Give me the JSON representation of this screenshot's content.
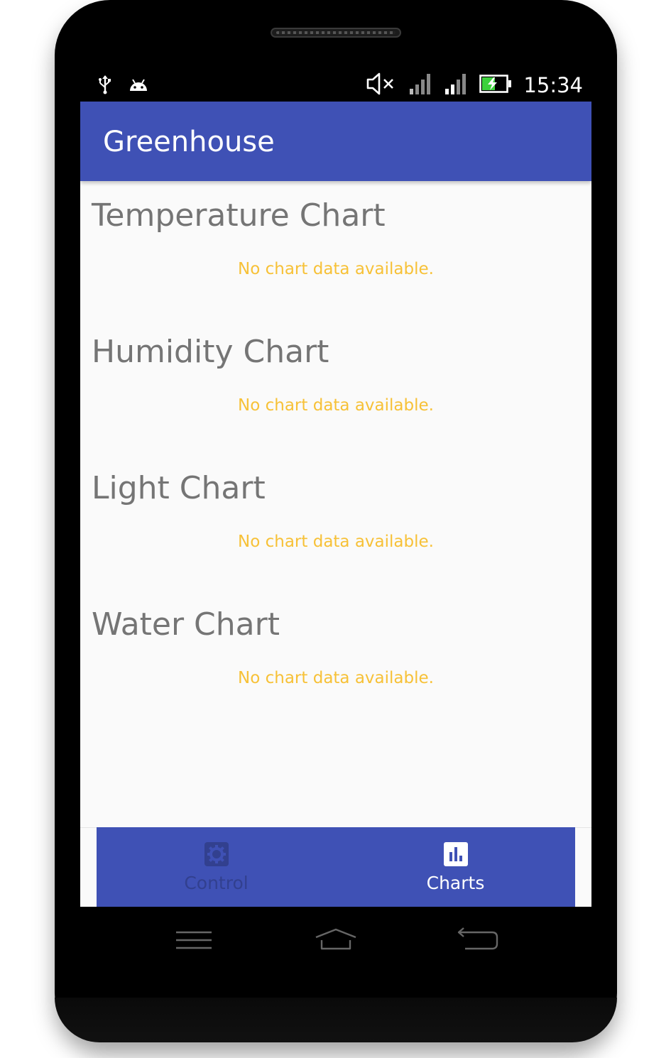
{
  "status_bar": {
    "time": "15:34",
    "left_icons": [
      "usb-icon",
      "android-icon"
    ],
    "right_icons": [
      "volume-muted-icon",
      "signal-icon",
      "signal-icon",
      "battery-charging-icon"
    ]
  },
  "app_bar": {
    "title": "Greenhouse"
  },
  "charts": [
    {
      "title": "Temperature Chart",
      "empty_text": "No chart data available."
    },
    {
      "title": "Humidity Chart",
      "empty_text": "No chart data available."
    },
    {
      "title": "Light Chart",
      "empty_text": "No chart data available."
    },
    {
      "title": "Water Chart",
      "empty_text": "No chart data available."
    }
  ],
  "bottom_nav": {
    "items": [
      {
        "label": "Control",
        "icon": "gear-icon",
        "active": false
      },
      {
        "label": "Charts",
        "icon": "bar-chart-icon",
        "active": true
      }
    ]
  },
  "hardware_nav": {
    "icons": [
      "menu-icon",
      "home-icon",
      "back-icon"
    ]
  },
  "colors": {
    "primary": "#3f51b5",
    "empty_text": "#f7c137",
    "title_text": "#757575",
    "inactive_nav": "#32408f"
  }
}
